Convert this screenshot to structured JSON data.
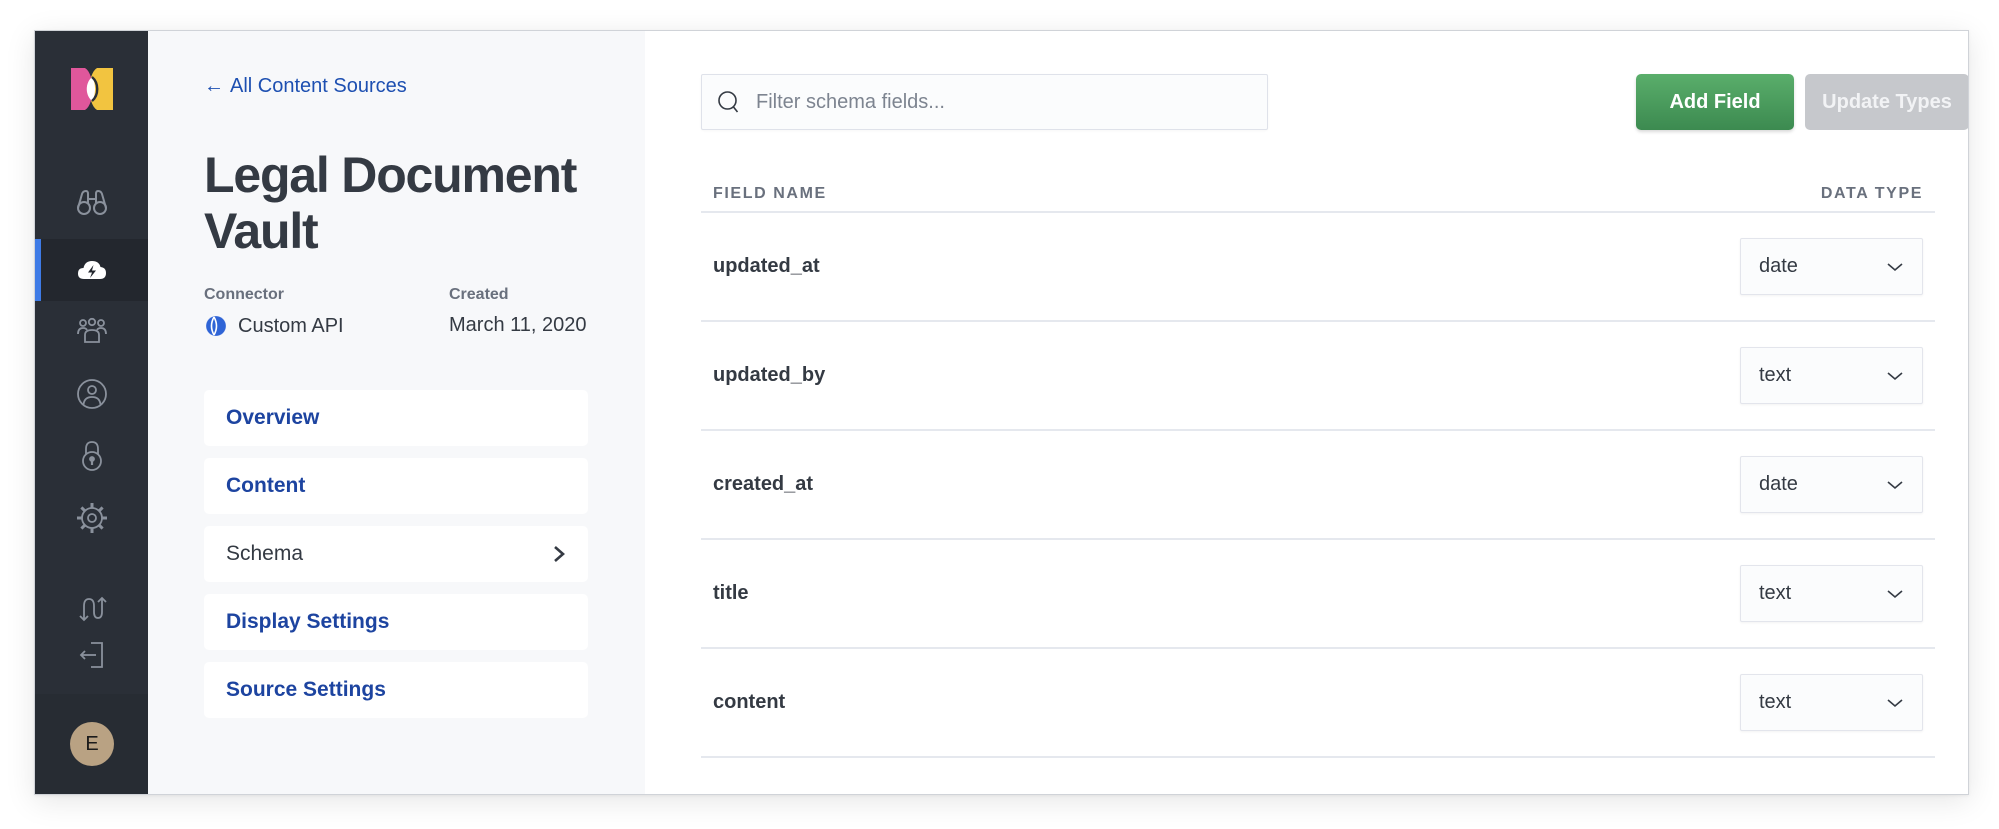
{
  "colors": {
    "rail_bg": "#2a2f37",
    "active_indicator": "#3e7be6",
    "link_blue": "#1d44a0",
    "add_button_green": "#4c9c5e",
    "disabled_button": "#c6c8cc",
    "avatar_bg": "#b9a283"
  },
  "rail": {
    "items": [
      {
        "name": "search-binoculars",
        "icon": "binoculars-icon"
      },
      {
        "name": "content-sources",
        "icon": "cloud-lightning-icon",
        "active": true
      },
      {
        "name": "groups",
        "icon": "users-group-icon"
      },
      {
        "name": "users",
        "icon": "user-circle-icon"
      },
      {
        "name": "security",
        "icon": "lock-icon"
      },
      {
        "name": "settings",
        "icon": "gear-icon"
      },
      {
        "name": "switch",
        "icon": "swap-arrows-icon"
      },
      {
        "name": "logout",
        "icon": "logout-icon"
      }
    ],
    "avatar_initial": "E"
  },
  "panel": {
    "back_link": "All Content Sources",
    "back_arrow": "←",
    "title": "Legal Document Vault",
    "connector_label": "Connector",
    "connector_value": "Custom API",
    "created_label": "Created",
    "created_value": "March 11, 2020",
    "nav": [
      {
        "label": "Overview"
      },
      {
        "label": "Content"
      },
      {
        "label": "Schema",
        "current": true
      },
      {
        "label": "Display Settings"
      },
      {
        "label": "Source Settings"
      }
    ]
  },
  "main": {
    "search_placeholder": "Filter schema fields...",
    "search_value": "",
    "add_field_label": "Add Field",
    "update_types_label": "Update Types",
    "columns": {
      "field_name": "FIELD NAME",
      "data_type": "DATA TYPE"
    },
    "rows": [
      {
        "field": "updated_at",
        "type": "date"
      },
      {
        "field": "updated_by",
        "type": "text"
      },
      {
        "field": "created_at",
        "type": "date"
      },
      {
        "field": "title",
        "type": "text"
      },
      {
        "field": "content",
        "type": "text"
      }
    ]
  }
}
